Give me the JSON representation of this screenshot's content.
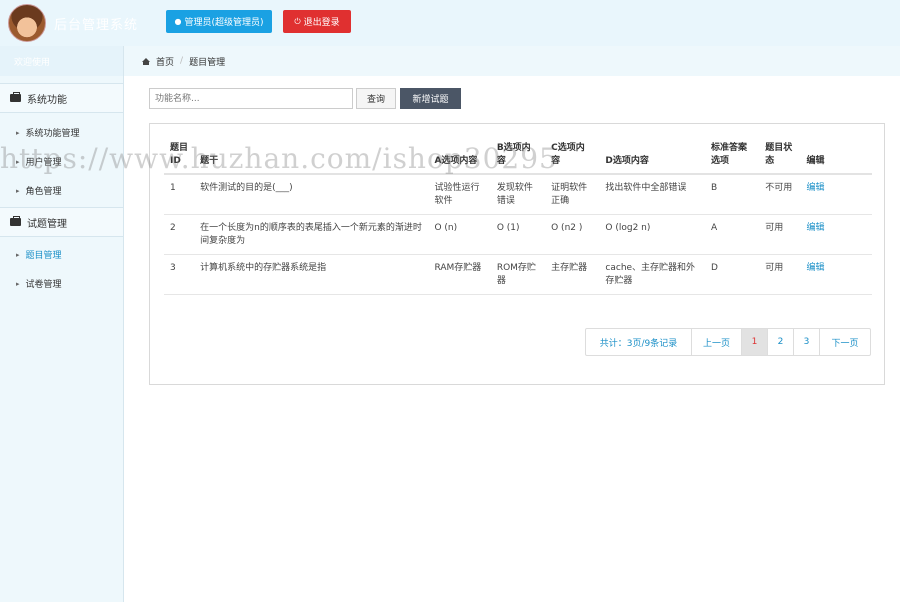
{
  "header": {
    "brand": "后台管理系统",
    "admin_button": "管理员(超级管理员)",
    "logout_button": "退出登录"
  },
  "sidebar": {
    "welcome": "欢迎使用",
    "sections": [
      {
        "label": "系统功能",
        "items": [
          "系统功能管理",
          "用户管理",
          "角色管理"
        ]
      },
      {
        "label": "试题管理",
        "items": [
          "题目管理",
          "试卷管理"
        ]
      }
    ]
  },
  "breadcrumb": {
    "home": "首页",
    "current": "题目管理"
  },
  "toolbar": {
    "search_placeholder": "功能名称...",
    "query_label": "查询",
    "add_label": "新增试题"
  },
  "table": {
    "headers": [
      "题目ID",
      "题干",
      "A选项内容",
      "B选项内容",
      "C选项内容",
      "D选项内容",
      "标准答案选项",
      "题目状态",
      "编辑"
    ],
    "rows": [
      [
        "1",
        "软件测试的目的是(___)",
        "试验性运行软件",
        "发现软件错误",
        "证明软件正确",
        "找出软件中全部错误",
        "B",
        "不可用",
        "编辑"
      ],
      [
        "2",
        "在一个长度为n的顺序表的表尾插入一个新元素的渐进时间复杂度为",
        "O (n)",
        "O (1)",
        "O (n2 )",
        "O (log2 n)",
        "A",
        "可用",
        "编辑"
      ],
      [
        "3",
        "计算机系统中的存贮器系统是指",
        "RAM存贮器",
        "ROM存贮器",
        "主存贮器",
        "cache、主存贮器和外存贮器",
        "D",
        "可用",
        "编辑"
      ]
    ]
  },
  "pagination": {
    "summary": "共计：3页/9条记录",
    "prev": "上一页",
    "pages": [
      "1",
      "2",
      "3"
    ],
    "current": "1",
    "next": "下一页"
  },
  "watermark": "https://www.huzhan.com/ishop30295",
  "colors": {
    "admin_button": "#1aa1e3",
    "logout_button": "#e03030",
    "add_button": "#4b5666",
    "link": "#1a8fc7",
    "sidebar_bg": "#eef8fc"
  }
}
